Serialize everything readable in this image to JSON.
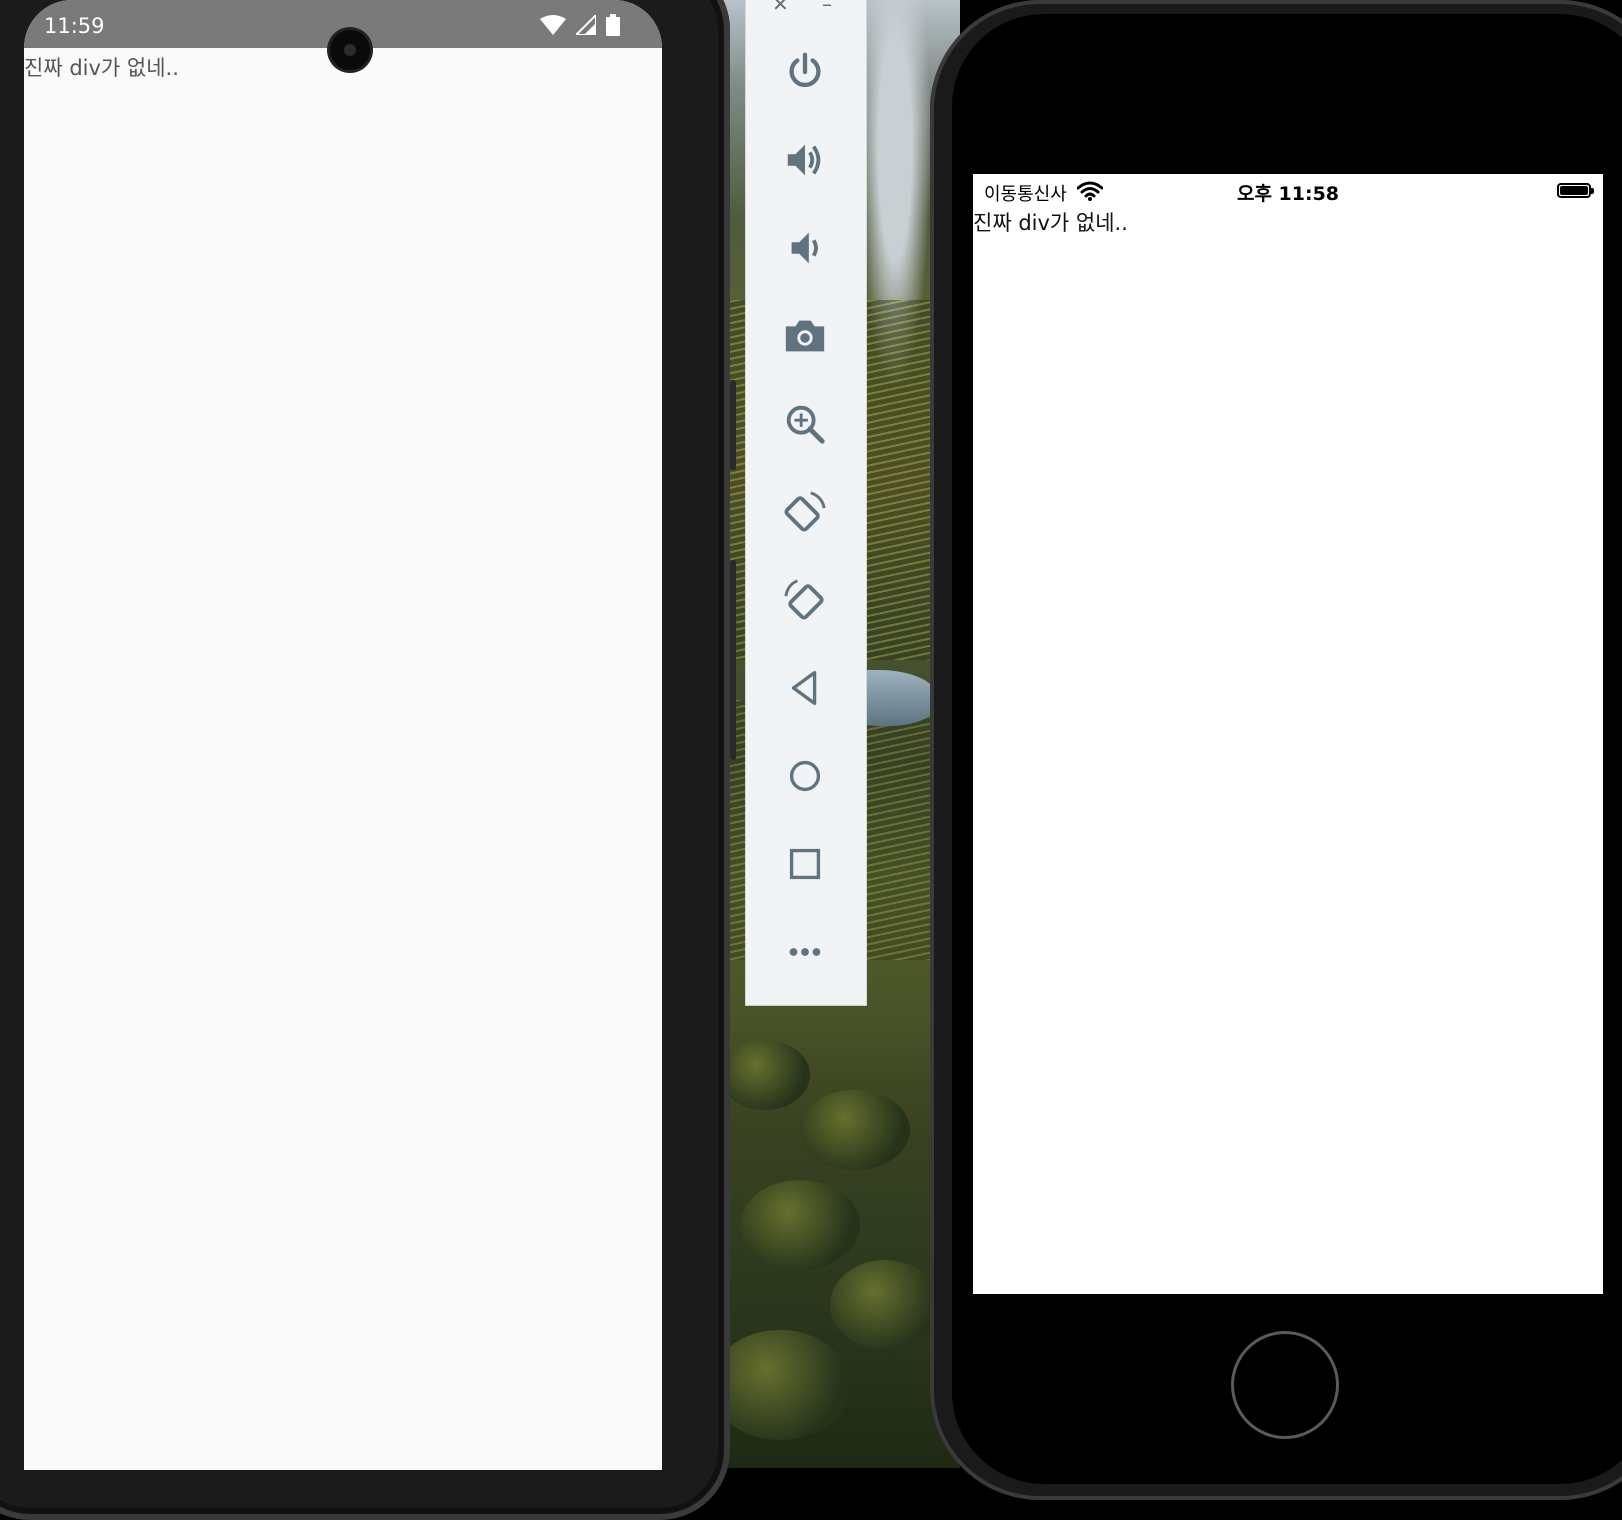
{
  "android": {
    "status_time": "11:59",
    "content_text": "진짜 div가 없네..",
    "icons": [
      "wifi-icon",
      "cellular-signal-icon",
      "battery-icon"
    ]
  },
  "emulator_toolbar": {
    "window_controls": {
      "close": "✕",
      "minimize": "–"
    },
    "buttons": [
      {
        "name": "power-icon"
      },
      {
        "name": "volume-up-icon"
      },
      {
        "name": "volume-down-icon"
      },
      {
        "name": "camera-icon"
      },
      {
        "name": "zoom-in-icon"
      },
      {
        "name": "rotate-left-icon"
      },
      {
        "name": "rotate-right-icon"
      },
      {
        "name": "back-triangle-icon"
      },
      {
        "name": "home-circle-icon"
      },
      {
        "name": "overview-square-icon"
      },
      {
        "name": "more-dots-icon"
      }
    ],
    "icon_color": "#5f7380"
  },
  "iphone": {
    "carrier": "이동통신사",
    "status_time": "오후 11:58",
    "content_text": "진짜 div가 없네.."
  }
}
